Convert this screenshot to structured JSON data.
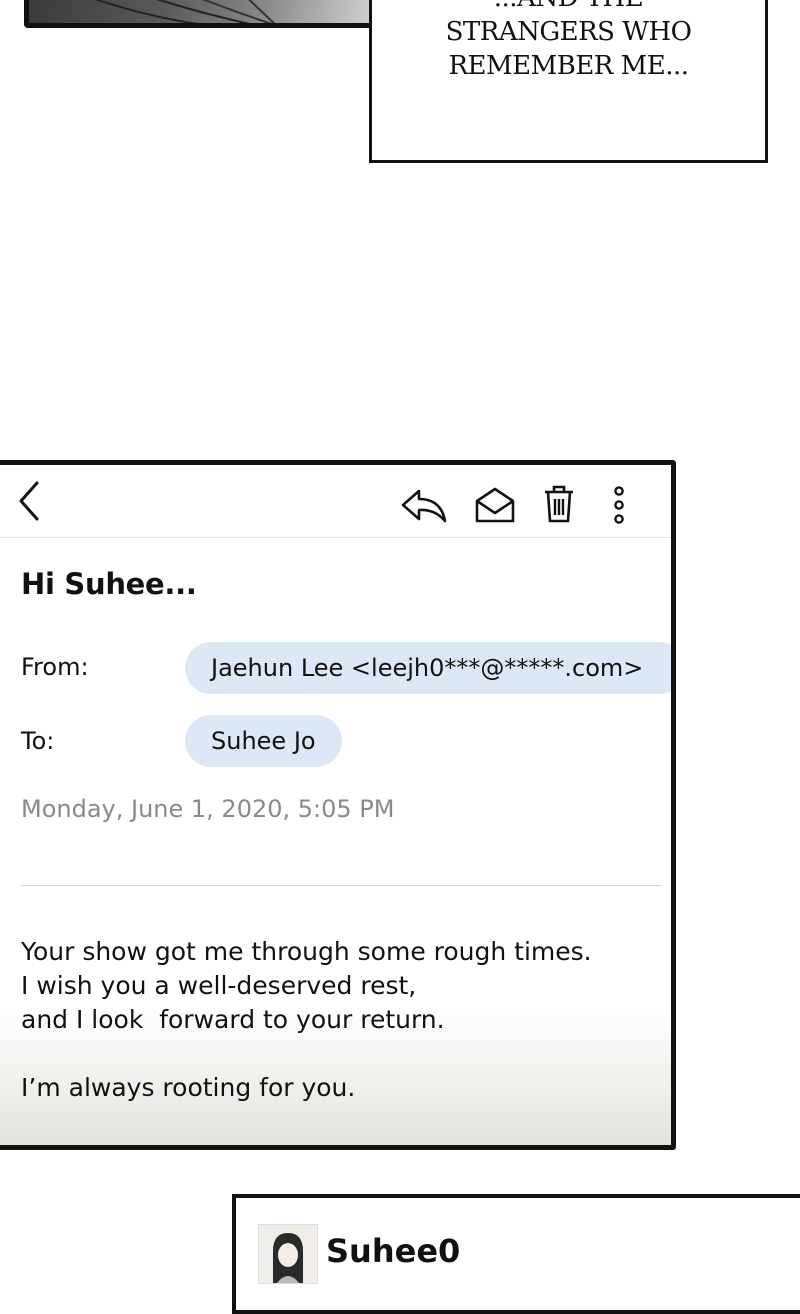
{
  "caption": {
    "lines": [
      "...AND THE",
      "STRANGERS WHO",
      "REMEMBER ME..."
    ]
  },
  "email": {
    "toolbar": {
      "back_icon": "chevron-left-icon",
      "reply_icon": "reply-icon",
      "mark_read_icon": "envelope-open-icon",
      "delete_icon": "trash-icon",
      "more_icon": "more-vertical-icon"
    },
    "subject": "Hi Suhee...",
    "from_label": "From:",
    "from_value": "Jaehun Lee <leejh0***@*****.com>",
    "to_label": "To:",
    "to_value": "Suhee Jo",
    "date": "Monday, June 1, 2020, 5:05 PM",
    "body_lines": [
      "Your show got me through some rough times.",
      "I wish you a well-deserved rest,",
      "and I look  forward to your return.",
      "",
      "I’m always rooting for you."
    ],
    "chip_color": "#dde8f6"
  },
  "profile": {
    "username": "Suhee0"
  }
}
